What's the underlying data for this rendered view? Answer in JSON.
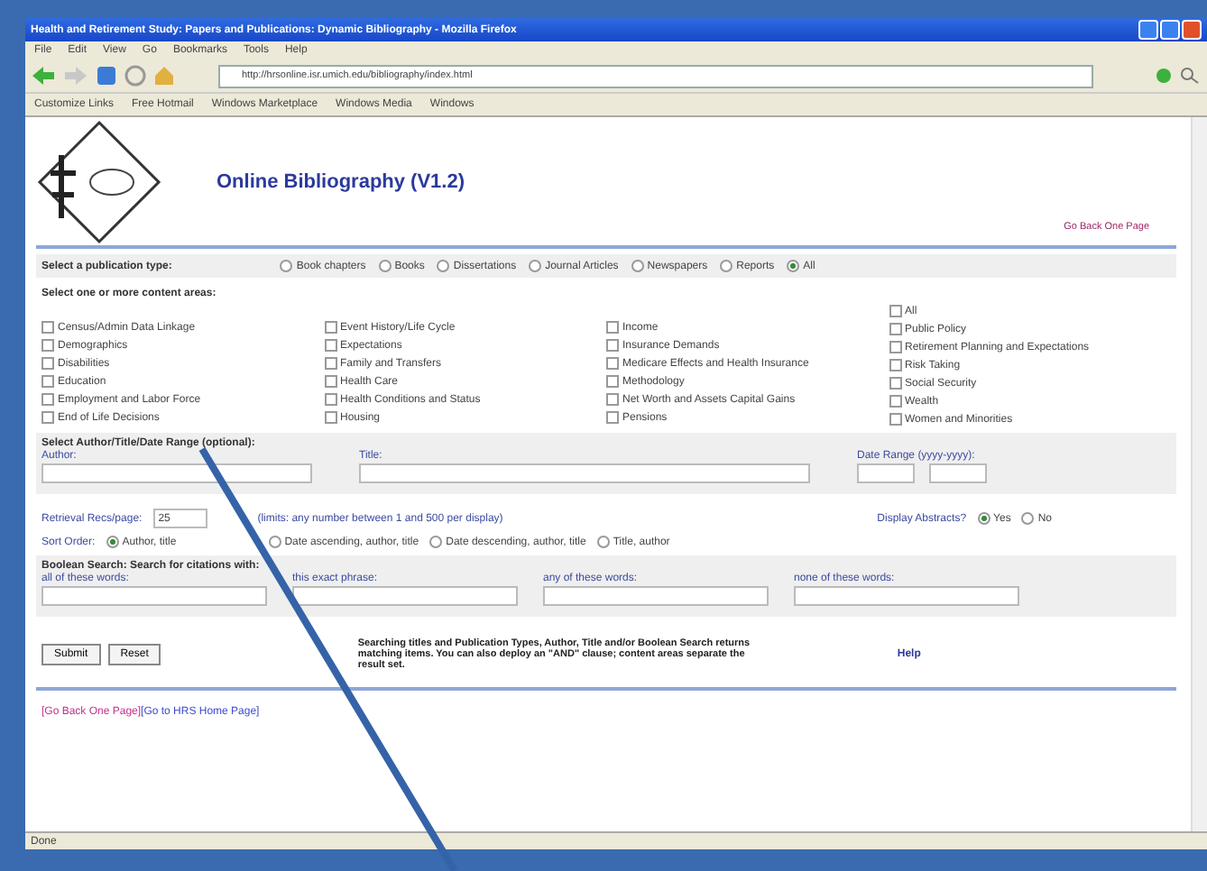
{
  "window": {
    "title": "Health and Retirement Study: Papers and Publications: Dynamic Bibliography - Mozilla Firefox"
  },
  "menu": [
    "File",
    "Edit",
    "View",
    "Go",
    "Bookmarks",
    "Tools",
    "Help"
  ],
  "address": "http://hrsonline.isr.umich.edu/bibliography/index.html",
  "bookmarks": [
    "Customize Links",
    "Free Hotmail",
    "Windows Marketplace",
    "Windows Media",
    "Windows"
  ],
  "page": {
    "title": "Online Bibliography (V1.2)",
    "back_link": "Go Back One Page",
    "publication_label": "Select a publication type:",
    "publication_types": [
      {
        "label": "Book chapters",
        "selected": false
      },
      {
        "label": "Books",
        "selected": false
      },
      {
        "label": "Dissertations",
        "selected": false
      },
      {
        "label": "Journal Articles",
        "selected": false
      },
      {
        "label": "Newspapers",
        "selected": false
      },
      {
        "label": "Reports",
        "selected": false
      },
      {
        "label": "All",
        "selected": true
      }
    ],
    "content_label": "Select one or more content areas:",
    "content_columns": [
      [
        {
          "label": "Census/Admin Data Linkage",
          "checked": false
        },
        {
          "label": "Demographics",
          "checked": false
        },
        {
          "label": "Disabilities",
          "checked": false
        },
        {
          "label": "Education",
          "checked": false
        },
        {
          "label": "Employment and Labor Force",
          "checked": false
        },
        {
          "label": "End of Life Decisions",
          "checked": false
        }
      ],
      [
        {
          "label": "Event History/Life Cycle",
          "checked": false
        },
        {
          "label": "Expectations",
          "checked": false
        },
        {
          "label": "Family and Transfers",
          "checked": false
        },
        {
          "label": "Health Care",
          "checked": false
        },
        {
          "label": "Health Conditions and Status",
          "checked": false
        },
        {
          "label": "Housing",
          "checked": false
        }
      ],
      [
        {
          "label": "Income",
          "checked": false
        },
        {
          "label": "Insurance Demands",
          "checked": false
        },
        {
          "label": "Medicare Effects and Health Insurance",
          "checked": false
        },
        {
          "label": "Methodology",
          "checked": false
        },
        {
          "label": "Net Worth and Assets Capital Gains",
          "checked": false
        },
        {
          "label": "Pensions",
          "checked": false
        }
      ],
      [
        {
          "label": "All",
          "checked": false
        },
        {
          "label": "Public Policy",
          "checked": false
        },
        {
          "label": "Retirement Planning and Expectations",
          "checked": false
        },
        {
          "label": "Risk Taking",
          "checked": false
        },
        {
          "label": "Social Security",
          "checked": false
        },
        {
          "label": "Wealth",
          "checked": false
        },
        {
          "label": "Women and Minorities",
          "checked": false
        }
      ]
    ],
    "author_section": "Select Author/Title/Date Range (optional):",
    "author_label": "Author:",
    "title_label": "Title:",
    "date_label": "Date Range (yyyy-yyyy):",
    "retrieval_label": "Retrieval Recs/page:",
    "retrieval_value": "25",
    "retrieval_hint": "(limits: any number between 1 and 500 per display)",
    "abstracts_label": "Display Abstracts?",
    "abstracts": [
      {
        "label": "Yes",
        "selected": true
      },
      {
        "label": "No",
        "selected": false
      }
    ],
    "sort_label": "Sort Order:",
    "sort_options": [
      {
        "label": "Author, title",
        "selected": true
      },
      {
        "label": "Date ascending, author, title",
        "selected": false
      },
      {
        "label": "Date descending, author, title",
        "selected": false
      },
      {
        "label": "Title, author",
        "selected": false
      }
    ],
    "boolean_section": "Boolean Search: Search for citations with:",
    "boolean_fields": [
      "all of these words:",
      "this exact phrase:",
      "any of these words:",
      "none of these words:"
    ],
    "buttons": [
      "Submit",
      "Reset"
    ],
    "note": "Searching titles and Publication Types, Author, Title and/or Boolean Search returns matching items. You can also deploy an \"AND\" clause; content areas separate the result set.",
    "help": "Help",
    "footer_links": [
      "[Go Back One Page]",
      "[Go to HRS Home Page]"
    ]
  },
  "status_bar": "Done"
}
